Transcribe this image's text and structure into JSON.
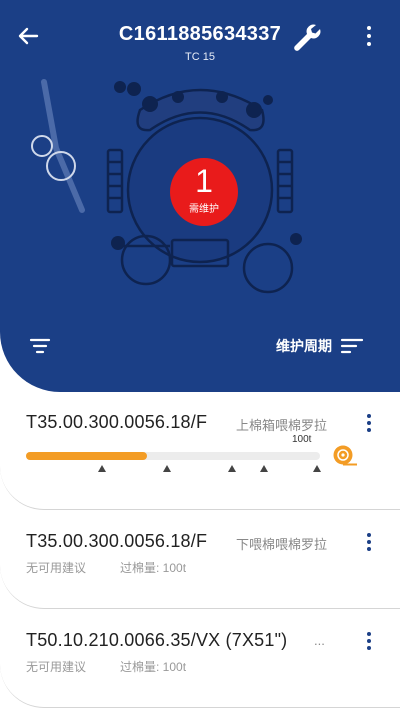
{
  "header": {
    "machine_id": "C1611885634337",
    "machine_sub": "TC 15",
    "maintenance_count": "1",
    "maintenance_label": "需维护",
    "cycle_label": "维护周期"
  },
  "parts": [
    {
      "part_no": "T35.00.300.0056.18/F",
      "desc": "上棉箱喂棉罗拉",
      "max_label": "100t",
      "progress": 0.41,
      "marker_positions": [
        0.26,
        0.48,
        0.7,
        0.81,
        0.99
      ]
    },
    {
      "part_no": "T35.00.300.0056.18/F",
      "desc": "下喂棉喂棉罗拉",
      "suggestion": "无可用建议",
      "throughput": "过棉量: 100t"
    },
    {
      "part_no": "T50.10.210.0066.35/VX (7X51\")",
      "desc": "...",
      "suggestion": "无可用建议",
      "throughput": "过棉量: 100t"
    }
  ],
  "colors": {
    "header_bg": "#1b3f86",
    "badge": "#e91b1b",
    "progress": "#f39c25"
  }
}
